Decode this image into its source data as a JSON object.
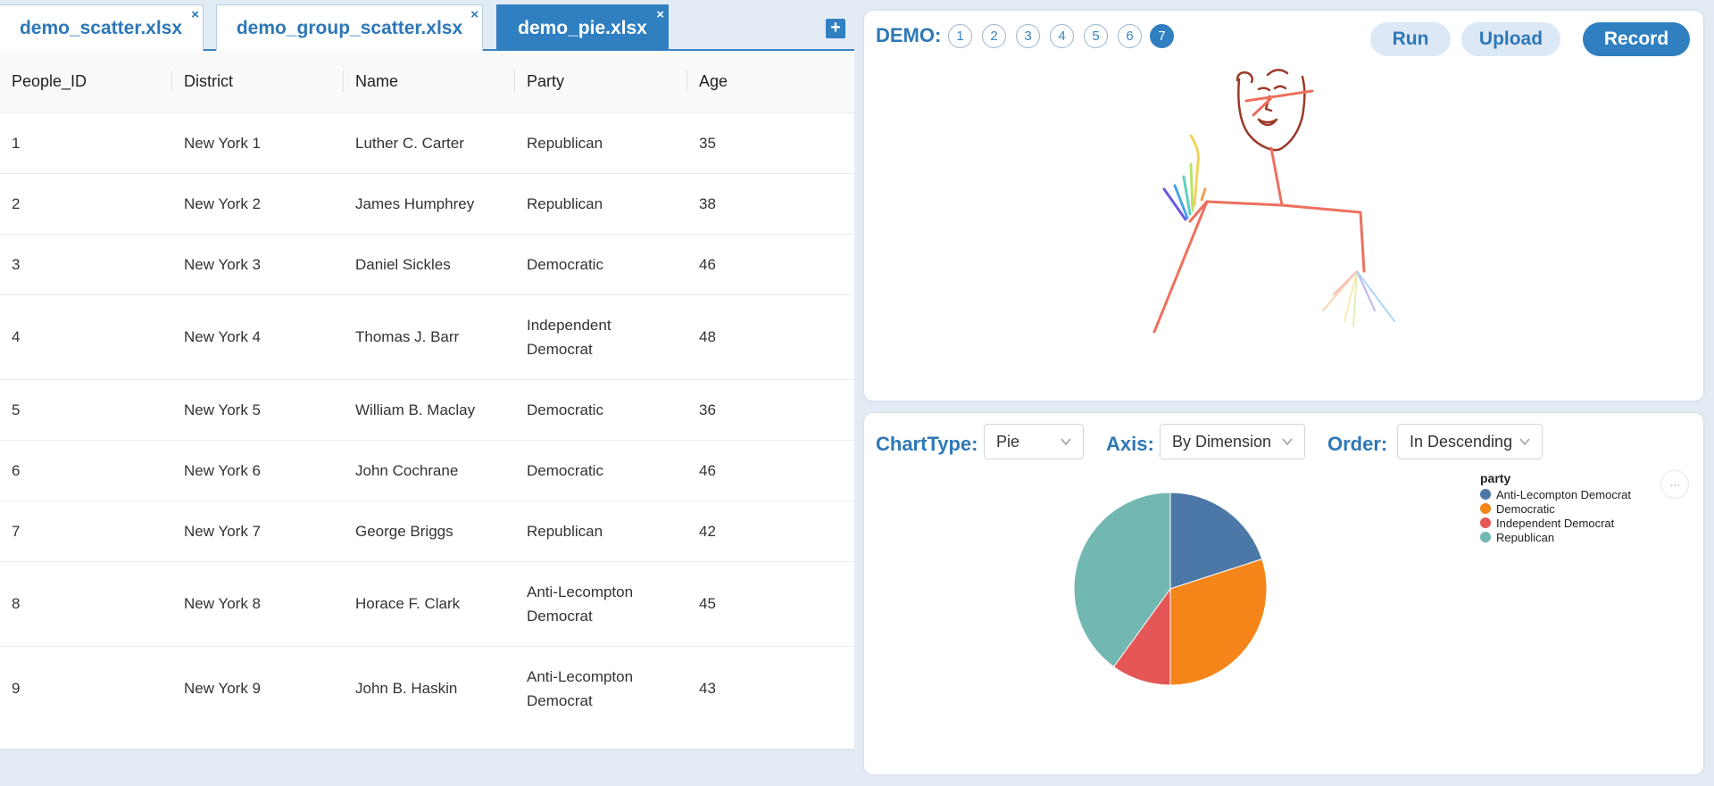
{
  "tabs": [
    {
      "label": "demo_scatter.xlsx",
      "active": false
    },
    {
      "label": "demo_group_scatter.xlsx",
      "active": false
    },
    {
      "label": "demo_pie.xlsx",
      "active": true
    }
  ],
  "tab_close_glyph": "×",
  "add_tab_glyph": "+",
  "table": {
    "columns": [
      "People_ID",
      "District",
      "Name",
      "Party",
      "Age"
    ],
    "rows": [
      [
        "1",
        "New York 1",
        "Luther C. Carter",
        "Republican",
        "35"
      ],
      [
        "2",
        "New York 2",
        "James Humphrey",
        "Republican",
        "38"
      ],
      [
        "3",
        "New York 3",
        "Daniel Sickles",
        "Democratic",
        "46"
      ],
      [
        "4",
        "New York 4",
        "Thomas J. Barr",
        "Independent Democrat",
        "48"
      ],
      [
        "5",
        "New York 5",
        "William B. Maclay",
        "Democratic",
        "36"
      ],
      [
        "6",
        "New York 6",
        "John Cochrane",
        "Democratic",
        "46"
      ],
      [
        "7",
        "New York 7",
        "George Briggs",
        "Republican",
        "42"
      ],
      [
        "8",
        "New York 8",
        "Horace F. Clark",
        "Anti-Lecompton Democrat",
        "45"
      ],
      [
        "9",
        "New York 9",
        "John B. Haskin",
        "Anti-Lecompton Democrat",
        "43"
      ]
    ]
  },
  "demo": {
    "label": "DEMO:",
    "numbers": [
      "1",
      "2",
      "3",
      "4",
      "5",
      "6",
      "7"
    ],
    "active_number": "7",
    "buttons": {
      "run": "Run",
      "upload": "Upload",
      "record": "Record"
    }
  },
  "controls": {
    "chart_type_label": "ChartType:",
    "chart_type_value": "Pie",
    "axis_label": "Axis:",
    "axis_value": "By Dimension",
    "order_label": "Order:",
    "order_value": "In Descending"
  },
  "more_glyph": "···",
  "colors": {
    "accent": "#2f7fc1",
    "accent_light": "#dce8f5",
    "anti_lecompton": "#4c78a8",
    "democratic": "#f58518",
    "independent": "#e45756",
    "republican": "#72b7b2"
  },
  "chart_data": {
    "type": "pie",
    "legend_title": "party",
    "legend_position": "top-right",
    "slices": [
      {
        "name": "Anti-Lecompton Democrat",
        "value": 2,
        "color": "#4c78a8"
      },
      {
        "name": "Democratic",
        "value": 3,
        "color": "#f58518"
      },
      {
        "name": "Independent Democrat",
        "value": 1,
        "color": "#e45756"
      },
      {
        "name": "Republican",
        "value": 4,
        "color": "#72b7b2"
      }
    ]
  }
}
